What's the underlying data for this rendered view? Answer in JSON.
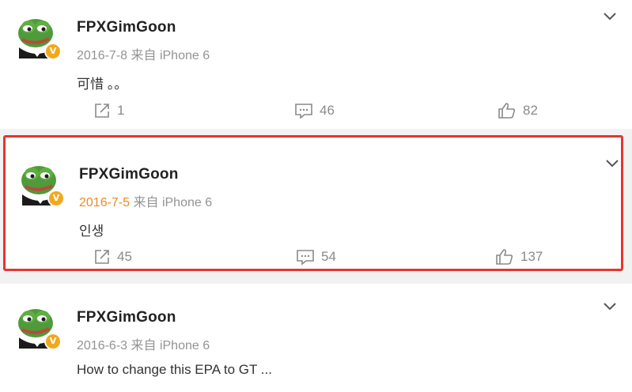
{
  "posts": [
    {
      "username": "FPXGimGoon",
      "date": "2016-7-8",
      "source": "来自 iPhone 6",
      "text": "可惜 。。",
      "share_count": "1",
      "comment_count": "46",
      "like_count": "82"
    },
    {
      "username": "FPXGimGoon",
      "date": "2016-7-5",
      "source": "来自 iPhone 6",
      "text": "인생",
      "share_count": "45",
      "comment_count": "54",
      "like_count": "137"
    },
    {
      "username": "FPXGimGoon",
      "date": "2016-6-3",
      "source": "来自 iPhone 6",
      "text": "How to change this EPA to GT ..."
    }
  ],
  "verified_badge": "V",
  "icons": {
    "share": "share-icon",
    "comment": "comment-icon",
    "like": "thumbs-up-icon",
    "expand": "chevron-down-icon",
    "avatar": "pepe-frog-avatar"
  },
  "colors": {
    "highlight_border": "#e4362f",
    "date_accent": "#f08a24",
    "verified": "#f2a81d"
  }
}
